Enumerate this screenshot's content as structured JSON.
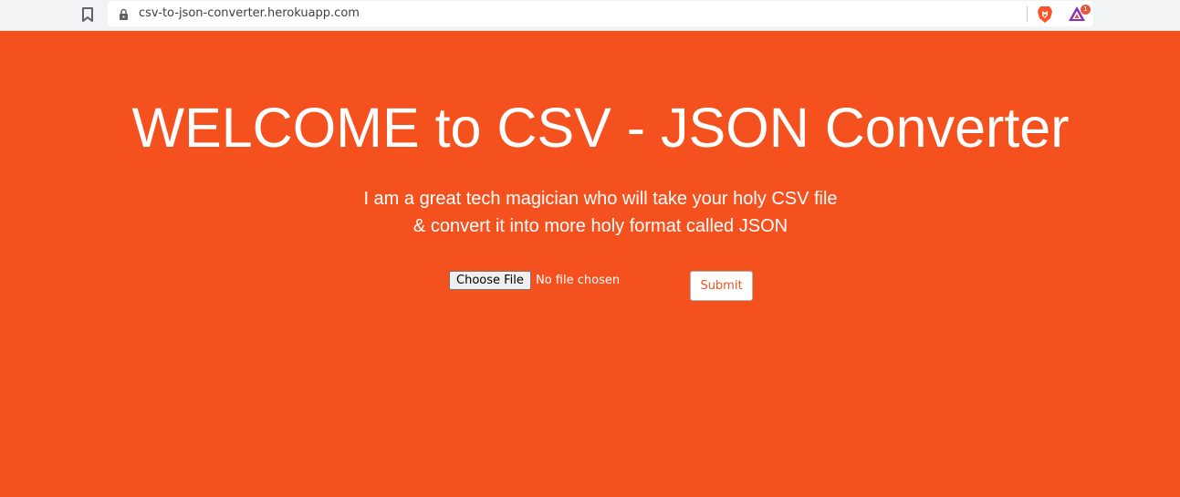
{
  "browser": {
    "url": "csv-to-json-converter.herokuapp.com",
    "icons": [
      "bookmark-icon",
      "lock-icon",
      "brave-shield-icon",
      "brave-rewards-icon"
    ],
    "rewards_badge_count": "1"
  },
  "page": {
    "background_color": "#f5511e",
    "title": "WELCOME to CSV - JSON Converter",
    "subtitle_line1": "I am a great tech magician who will take your holy CSV file",
    "subtitle_line2": "& convert it into more holy format called JSON",
    "file_input": {
      "button_label": "Choose File",
      "status": "No file chosen"
    },
    "submit_label": "Submit"
  }
}
